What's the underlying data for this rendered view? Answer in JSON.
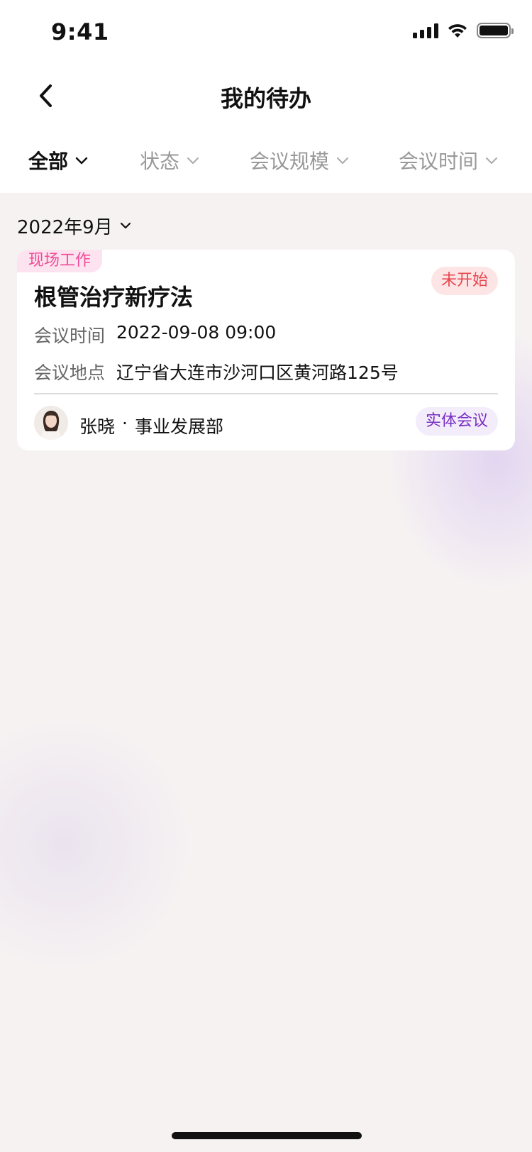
{
  "status_bar": {
    "time": "9:41"
  },
  "nav": {
    "title": "我的待办",
    "back_icon": "chevron-left-icon"
  },
  "filters": [
    {
      "label": "全部",
      "active": true
    },
    {
      "label": "状态",
      "active": false
    },
    {
      "label": "会议规模",
      "active": false
    },
    {
      "label": "会议时间",
      "active": false
    }
  ],
  "month": {
    "label": "2022年9月"
  },
  "card": {
    "corner_tag": "现场工作",
    "status": "未开始",
    "title": "根管治疗新疗法",
    "rows": [
      {
        "label": "会议时间",
        "value": "2022-09-08 09:00"
      },
      {
        "label": "会议地点",
        "value": "辽宁省大连市沙河口区黄河路125号"
      }
    ],
    "person": {
      "name": "张晓",
      "separator": "·",
      "department": "事业发展部"
    },
    "type": "实体会议"
  },
  "colors": {
    "accent_pink": "#ef4b97",
    "status_red": "#e8474f",
    "type_purple": "#7a2fc2"
  }
}
